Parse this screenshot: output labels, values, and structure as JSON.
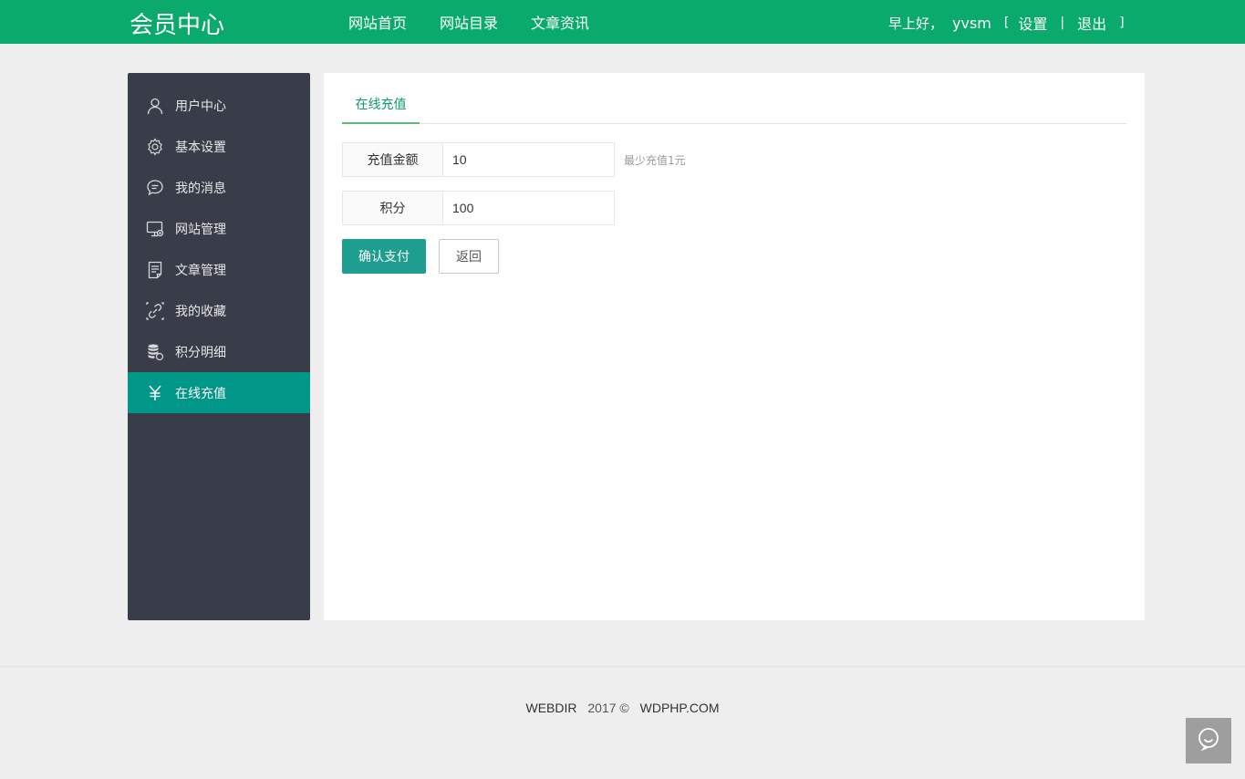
{
  "header": {
    "logo": "会员中心",
    "nav": [
      "网站首页",
      "网站目录",
      "文章资讯"
    ],
    "greeting": "早上好，",
    "username": "yvsm",
    "bracket_open": "[",
    "settings": "设置",
    "separator": "|",
    "logout": "退出",
    "bracket_close": "]"
  },
  "sidebar": {
    "items": [
      {
        "label": "用户中心",
        "icon": "user-icon"
      },
      {
        "label": "基本设置",
        "icon": "gear-icon"
      },
      {
        "label": "我的消息",
        "icon": "chat-icon"
      },
      {
        "label": "网站管理",
        "icon": "monitor-icon"
      },
      {
        "label": "文章管理",
        "icon": "document-icon"
      },
      {
        "label": "我的收藏",
        "icon": "link-icon"
      },
      {
        "label": "积分明细",
        "icon": "coins-icon"
      },
      {
        "label": "在线充值",
        "icon": "yen-icon",
        "active": true
      }
    ]
  },
  "main": {
    "tab": "在线充值",
    "amount_label": "充值金额",
    "amount_value": "10",
    "amount_hint": "最少充值1元",
    "points_label": "积分",
    "points_value": "100",
    "confirm_button": "确认支付",
    "back_button": "返回"
  },
  "footer": {
    "brand": "WEBDIR",
    "year": "2017 ©",
    "site": "WDPHP.COM"
  },
  "colors": {
    "header": "#0aa96c",
    "sidebar": "#393d49",
    "active": "#009688",
    "primary_button": "#1e9e8f"
  }
}
